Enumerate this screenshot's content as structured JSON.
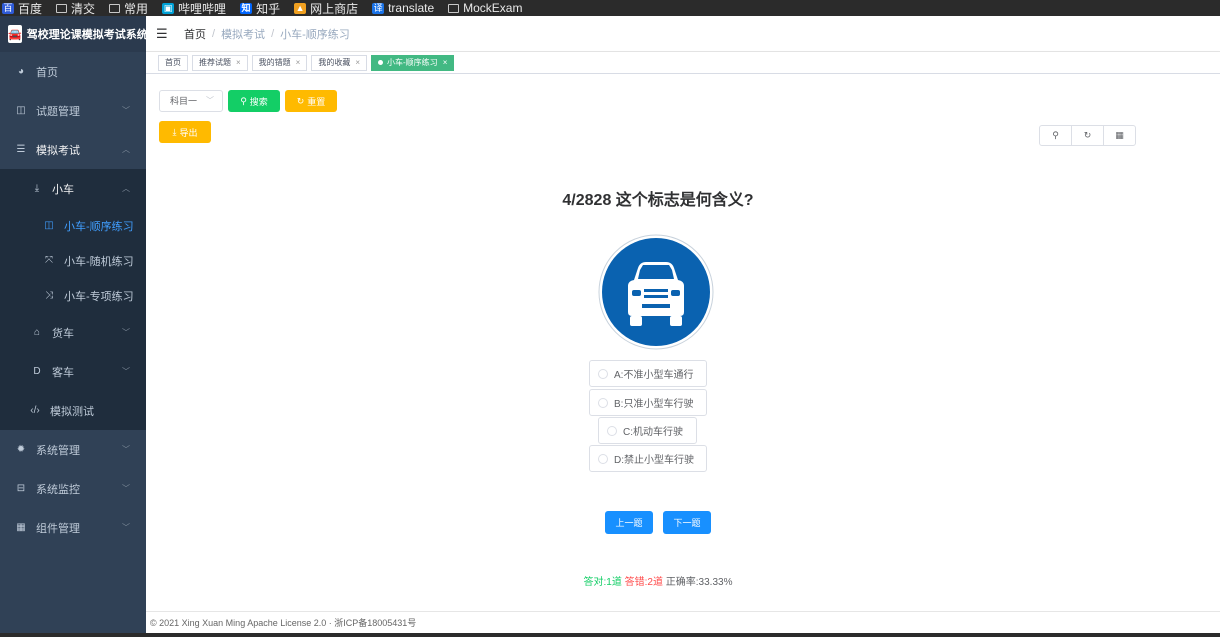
{
  "bookmarks": [
    {
      "label": "百度",
      "icon": "baidu-icon"
    },
    {
      "label": "清交",
      "icon": "folder-icon"
    },
    {
      "label": "常用",
      "icon": "folder-icon"
    },
    {
      "label": "哔哩哔哩",
      "icon": "bilibili-icon"
    },
    {
      "label": "知乎",
      "icon": "zhihu-icon"
    },
    {
      "label": "网上商店",
      "icon": "shop-icon"
    },
    {
      "label": "translate",
      "icon": "translate-icon"
    },
    {
      "label": "MockExam",
      "icon": "folder-icon"
    }
  ],
  "app": {
    "title": "驾校理论课模拟考试系统"
  },
  "sidebar": {
    "home": "首页",
    "questions": "试题管理",
    "exam": "模拟考试",
    "car": "小车",
    "car_sequential": "小车-顺序练习",
    "car_random": "小车-随机练习",
    "car_special": "小车-专项练习",
    "truck": "货车",
    "bus": "客车",
    "mock_test": "模拟测试",
    "system": "系统管理",
    "monitor": "系统监控",
    "components": "组件管理"
  },
  "breadcrumb": [
    "首页",
    "模拟考试",
    "小车-顺序练习"
  ],
  "tags": [
    {
      "label": "首页",
      "closable": false,
      "active": false
    },
    {
      "label": "推荐试题",
      "closable": true,
      "active": false
    },
    {
      "label": "我的错题",
      "closable": true,
      "active": false
    },
    {
      "label": "我的收藏",
      "closable": true,
      "active": false
    },
    {
      "label": "小车-顺序练习",
      "closable": true,
      "active": true
    }
  ],
  "tag_close": "×",
  "toolbar": {
    "subject_select": "科目一",
    "search_label": "搜索",
    "reset_label": "重置",
    "export_label": "导出"
  },
  "question": {
    "progress": "4/2828",
    "text": "这个标志是何含义?",
    "options": [
      "A:不准小型车通行",
      "B:只准小型车行驶",
      "C:机动车行驶",
      "D:禁止小型车行驶"
    ]
  },
  "nav": {
    "prev": "上一题",
    "next": "下一题"
  },
  "stats": {
    "correct": "答对:1道",
    "wrong": "答错:2道",
    "rate": "正确率:33.33%"
  },
  "footer": "© 2021 Xing Xuan Ming Apache License 2.0 · 浙ICP备18005431号",
  "colors": {
    "sidebar_bg": "#304156",
    "active_tag": "#42b983",
    "primary": "#1890ff",
    "success": "#13ce66",
    "warning": "#ffba00",
    "sign_blue": "#0a62b0"
  }
}
